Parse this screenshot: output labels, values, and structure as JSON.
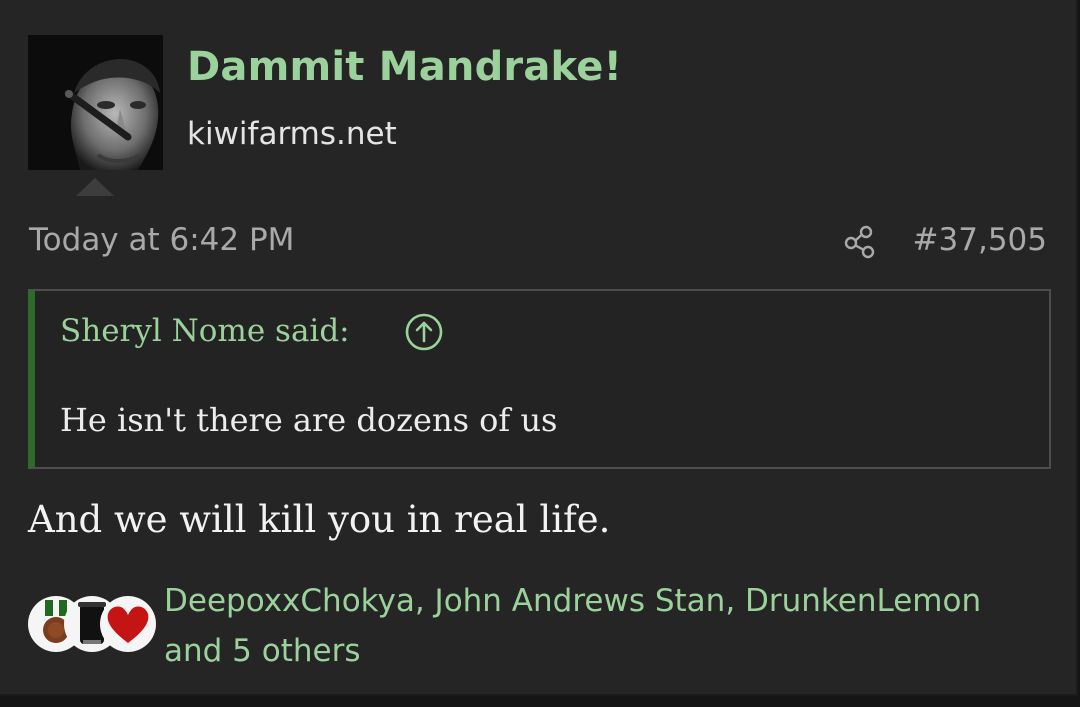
{
  "post": {
    "username": "Dammit Mandrake!",
    "user_title": "kiwifarms.net",
    "timestamp": "Today at 6:42 PM",
    "post_number": "#37,505",
    "quote": {
      "author": "Sheryl Nome said:",
      "text": "He isn't there are dozens of us"
    },
    "message": "And we will kill you in real life.",
    "reactions": {
      "icons": [
        "medal-icon",
        "black-mug-icon",
        "heart-icon"
      ],
      "line1": "DeepoxxChokya, John Andrews Stan, DrunkenLemon",
      "line2": "and 5 others"
    }
  },
  "colors": {
    "accent_green": "#9bd19b",
    "quote_bar": "#2f6a2c",
    "post_bg": "#252525",
    "muted_text": "#a9a9a9"
  },
  "icons": {
    "share": "share-icon",
    "quote_jump": "arrow-up-circle-icon",
    "avatar_caret": "caret-up-icon"
  }
}
